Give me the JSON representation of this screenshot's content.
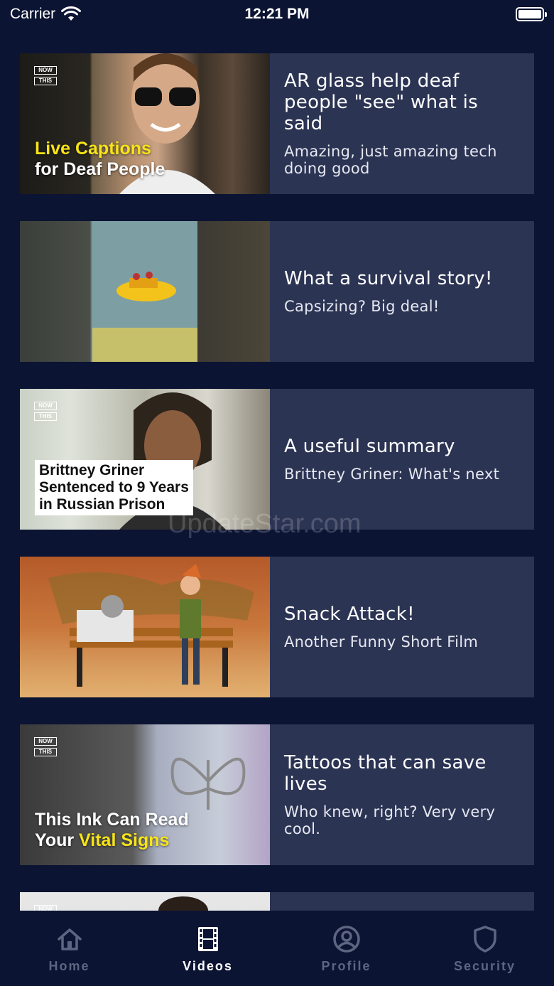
{
  "status_bar": {
    "carrier": "Carrier",
    "time": "12:21 PM",
    "battery_level": 1.0
  },
  "videos": [
    {
      "title": "AR glass help deaf people \"see\" what is said",
      "subtitle": "Amazing, just amazing tech doing good",
      "thumb_line1": "Live Captions",
      "thumb_line2": "for Deaf People",
      "thumb_badge": [
        "NOW",
        "THIS"
      ]
    },
    {
      "title": "What a survival story!",
      "subtitle": "Capsizing? Big deal!"
    },
    {
      "title": "A useful summary",
      "subtitle": "Brittney Griner: What's next",
      "thumb_line1": "Brittney Griner",
      "thumb_line2": "Sentenced to 9 Years",
      "thumb_line3": "in Russian Prison",
      "thumb_badge": [
        "NOW",
        "THIS"
      ]
    },
    {
      "title": "Snack Attack!",
      "subtitle": "Another Funny Short Film"
    },
    {
      "title": "Tattoos that can save lives",
      "subtitle": "Who knew, right? Very very cool.",
      "thumb_line1": "This Ink Can Read",
      "thumb_line2a": "Your ",
      "thumb_line2b": "Vital Signs",
      "thumb_badge": [
        "NOW",
        "THIS"
      ]
    }
  ],
  "watermark": "UpdateStar.com",
  "tabs": [
    {
      "label": "Home",
      "icon": "home-icon",
      "active": false
    },
    {
      "label": "Videos",
      "icon": "film-icon",
      "active": true
    },
    {
      "label": "Profile",
      "icon": "profile-icon",
      "active": false
    },
    {
      "label": "Security",
      "icon": "shield-icon",
      "active": false
    }
  ],
  "colors": {
    "background": "#0c1433",
    "card": "#2c3454",
    "highlight": "#f7e417",
    "inactive_tab": "#5e6581"
  }
}
